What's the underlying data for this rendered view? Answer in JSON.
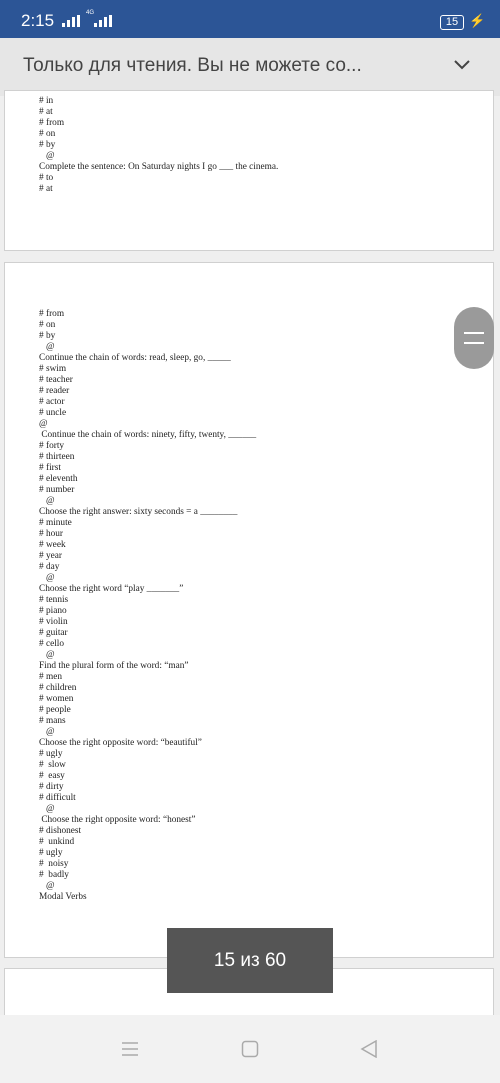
{
  "status_bar": {
    "time": "2:15",
    "network": "4G",
    "battery": "15"
  },
  "header": {
    "title": "Только для чтения. Вы не можете со..."
  },
  "pages": [
    {
      "lines": [
        "# in",
        "# at",
        "# from",
        "# on",
        "# by",
        "   @",
        "Complete the sentence: On Saturday nights I go ___ the cinema.",
        "# to",
        "# at"
      ]
    },
    {
      "lines": [
        "# from",
        "# on",
        "# by",
        "   @",
        "Continue the chain of words: read, sleep, go, _____",
        "# swim",
        "# teacher",
        "# reader",
        "# actor",
        "# uncle",
        "@",
        " Continue the chain of words: ninety, fifty, twenty, ______",
        "# forty",
        "# thirteen",
        "# first",
        "# eleventh",
        "# number",
        "   @",
        "Choose the right answer: sixty seconds = a ________",
        "# minute",
        "# hour",
        "# week",
        "# year",
        "# day",
        "   @",
        "Choose the right word “play _______”",
        "# tennis",
        "# piano",
        "# violin",
        "# guitar",
        "# cello",
        "   @",
        "Find the plural form of the word: “man”",
        "# men",
        "# children",
        "# women",
        "# people",
        "# mans",
        "   @",
        "Choose the right opposite word: “beautiful”",
        "# ugly",
        "#  slow",
        "#  easy",
        "# dirty",
        "# difficult",
        "   @",
        " Choose the right opposite word: “honest”",
        "# dishonest",
        "#  unkind",
        "# ugly",
        "#  noisy",
        "#  badly",
        "   @",
        "Modal Verbs"
      ]
    }
  ],
  "pager": {
    "label": "15 из 60"
  },
  "colors": {
    "status_bar": "#2c5596",
    "header": "#e6e6e6",
    "pager": "#555555"
  }
}
